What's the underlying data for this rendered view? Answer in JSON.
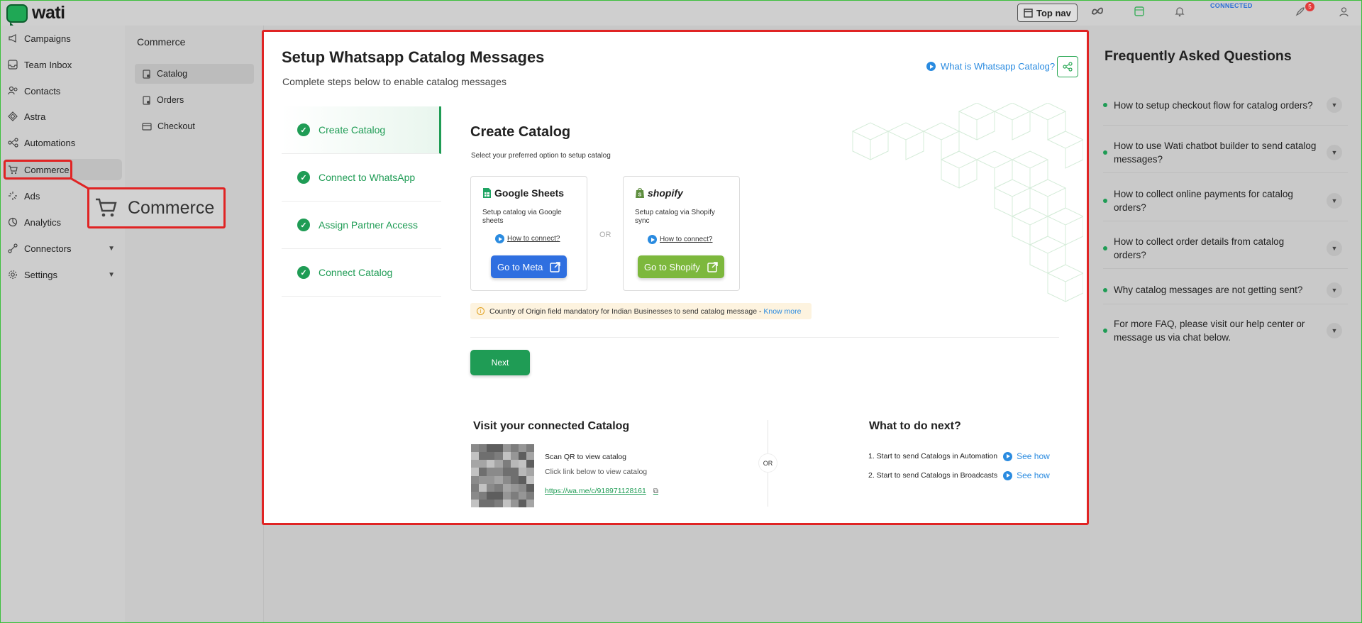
{
  "brand": {
    "name": "wati"
  },
  "topbar": {
    "topnav_label": "Top nav",
    "status": "CONNECTED",
    "notification_count": "5"
  },
  "sidebar": {
    "items": [
      {
        "label": "Campaigns",
        "icon": "megaphone-icon"
      },
      {
        "label": "Team Inbox",
        "icon": "inbox-icon"
      },
      {
        "label": "Contacts",
        "icon": "contacts-icon"
      },
      {
        "label": "Astra",
        "icon": "astra-icon"
      },
      {
        "label": "Automations",
        "icon": "automation-icon"
      },
      {
        "label": "Commerce",
        "icon": "cart-icon"
      },
      {
        "label": "Ads",
        "icon": "ads-icon"
      },
      {
        "label": "Analytics",
        "icon": "analytics-icon"
      },
      {
        "label": "Connectors",
        "icon": "connectors-icon"
      },
      {
        "label": "Settings",
        "icon": "gear-icon"
      }
    ],
    "callout_label": "Commerce"
  },
  "subsidebar": {
    "title": "Commerce",
    "items": [
      {
        "label": "Catalog"
      },
      {
        "label": "Orders"
      },
      {
        "label": "Checkout"
      }
    ]
  },
  "main": {
    "title": "Setup Whatsapp Catalog Messages",
    "subtitle": "Complete steps below to enable catalog messages",
    "whatis_link": "What is Whatsapp Catalog?",
    "steps": [
      {
        "label": "Create Catalog"
      },
      {
        "label": "Connect to WhatsApp"
      },
      {
        "label": "Assign Partner Access"
      },
      {
        "label": "Connect Catalog"
      }
    ],
    "create": {
      "title": "Create Catalog",
      "subtitle": "Select your preferred option to setup catalog",
      "or_label": "OR",
      "google": {
        "title": "Google Sheets",
        "desc": "Setup catalog via Google sheets",
        "how": "How to connect?",
        "button": "Go to Meta",
        "button_color": "#2f6fe0"
      },
      "shopify": {
        "title": "shopify",
        "desc": "Setup catalog via Shopify sync",
        "how": "How to connect?",
        "button": "Go to Shopify",
        "button_color": "#7db83d"
      },
      "warning_text": "Country of Origin field mandatory for Indian Businesses to send catalog message - ",
      "warning_link": "Know more",
      "next_button": "Next"
    },
    "visit": {
      "title": "Visit your connected Catalog",
      "scan": "Scan QR to view catalog",
      "click": "Click link below to view catalog",
      "link": "https://wa.me/c/918971128161",
      "or_label": "OR"
    },
    "next_steps": {
      "title": "What to do next?",
      "items": [
        {
          "text": "1. Start to send Catalogs in Automation",
          "link": "See how"
        },
        {
          "text": "2. Start to send Catalogs in Broadcasts",
          "link": "See how"
        }
      ]
    }
  },
  "faq": {
    "title": "Frequently Asked Questions",
    "items": [
      {
        "q": "How to setup checkout flow for catalog orders?"
      },
      {
        "q": "How to use Wati chatbot builder to send catalog messages?"
      },
      {
        "q": "How to collect online payments for catalog orders?"
      },
      {
        "q": "How to collect order details from catalog orders?"
      },
      {
        "q": "Why catalog messages are not getting sent?"
      },
      {
        "q": "For more FAQ, please visit our help center or message us via chat below."
      }
    ]
  },
  "colors": {
    "accent_green": "#1f9c55",
    "link_blue": "#2a8be0",
    "highlight_red": "#e02424"
  }
}
